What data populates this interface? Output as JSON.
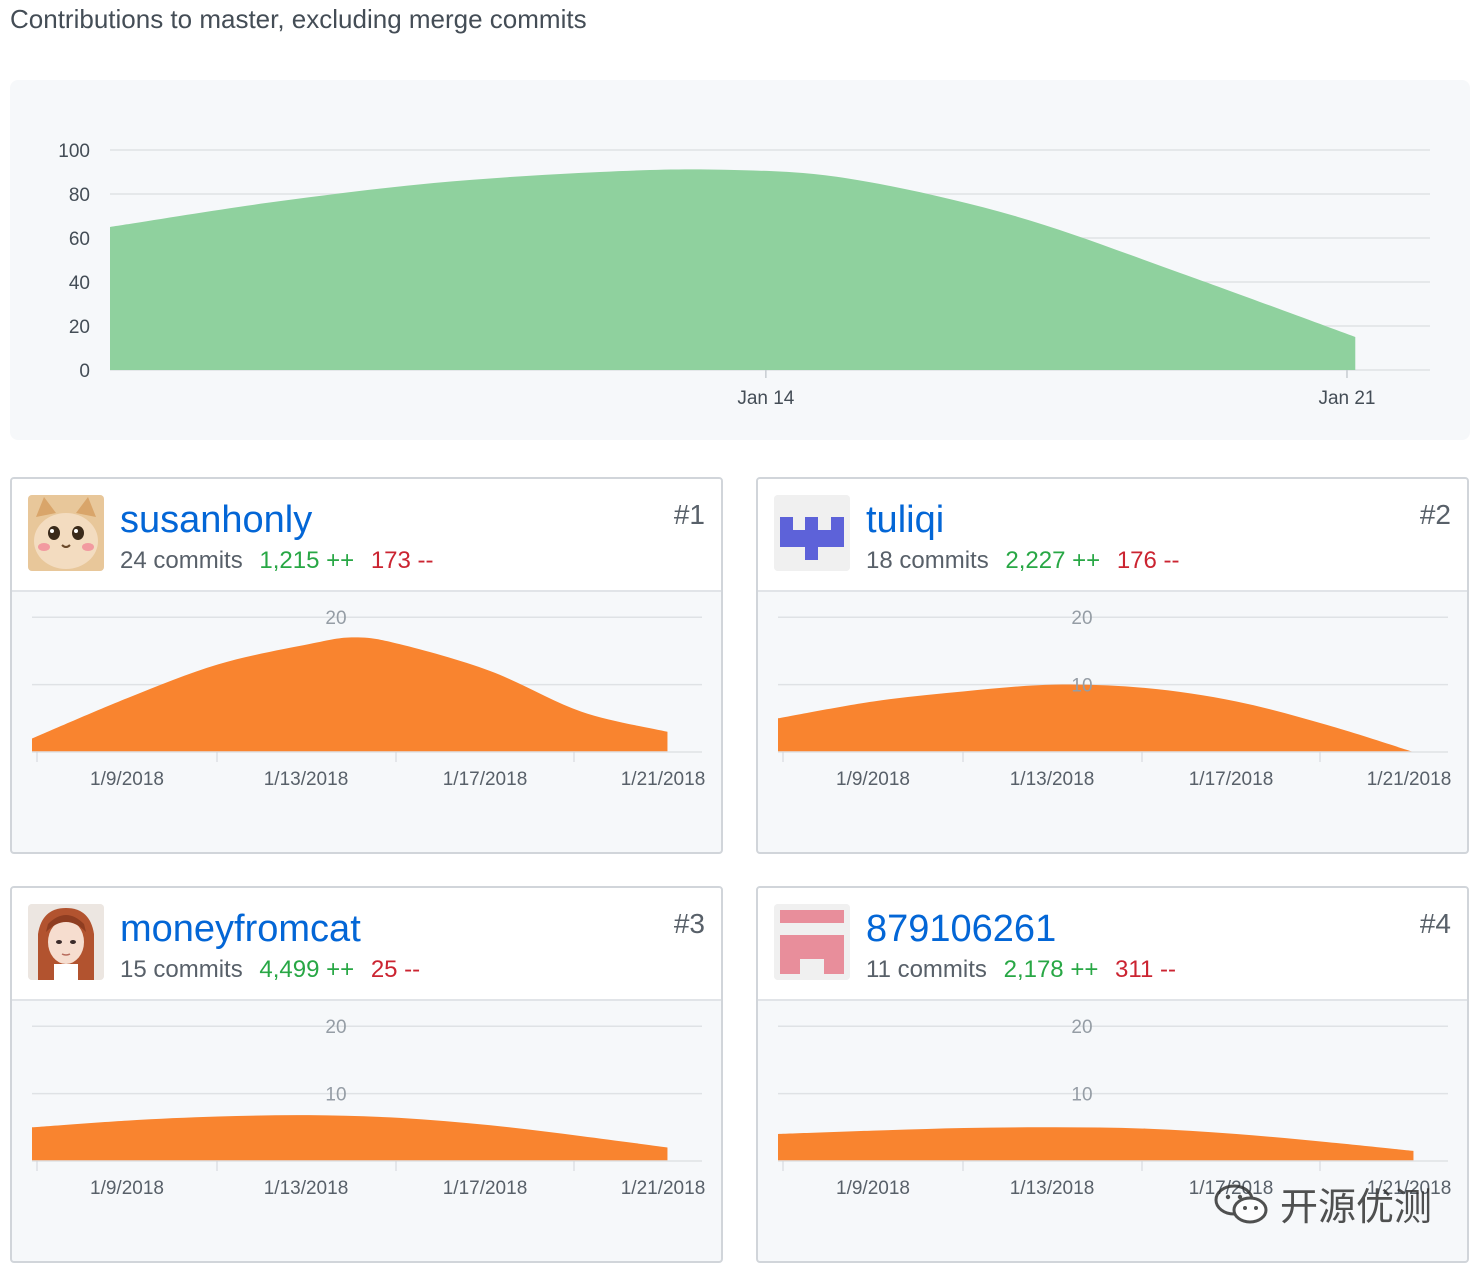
{
  "page": {
    "title": "Contributions to master, excluding merge commits"
  },
  "main_chart": {
    "chart_data": {
      "type": "area",
      "y_ticks": [
        "100",
        "80",
        "60",
        "40",
        "20",
        "0"
      ],
      "ylim": [
        0,
        100
      ],
      "x_ticks": [
        {
          "label": "Jan 14",
          "day": 14
        },
        {
          "label": "Jan 21",
          "day": 21
        }
      ],
      "xlim_days": [
        6.1,
        22
      ],
      "series": [
        {
          "x_days": [
            6.1,
            8,
            10,
            12,
            13.5,
            15,
            17,
            19,
            21.1
          ],
          "values": [
            65,
            76,
            85,
            90,
            91,
            87,
            70,
            44,
            15
          ]
        }
      ],
      "color": "#8fd19e"
    }
  },
  "contributors": [
    {
      "rank": "#1",
      "username": "susanhonly",
      "commits": "24 commits",
      "additions": "1,215 ++",
      "deletions": "173 --",
      "avatar": "cat-photo",
      "chart_data": {
        "type": "area",
        "y_ticks": [
          "20"
        ],
        "ylim": [
          0,
          23
        ],
        "x_labels": [
          "1/9/2018",
          "1/13/2018",
          "1/17/2018",
          "1/21/2018"
        ],
        "x_days": [
          6.9,
          9,
          11,
          13,
          14,
          15,
          17,
          19,
          20.9
        ],
        "values": [
          2,
          8,
          13,
          16,
          17,
          16,
          12,
          6,
          3
        ]
      }
    },
    {
      "rank": "#2",
      "username": "tuliqi",
      "commits": "18 commits",
      "additions": "2,227 ++",
      "deletions": "176 --",
      "avatar": "identicon-purple",
      "chart_data": {
        "type": "area",
        "y_ticks": [
          "20",
          "10"
        ],
        "ylim": [
          0,
          23
        ],
        "x_labels": [
          "1/9/2018",
          "1/13/2018",
          "1/17/2018",
          "1/21/2018"
        ],
        "x_days": [
          6.9,
          9,
          11,
          13,
          15,
          17,
          19,
          20.9
        ],
        "values": [
          5,
          7.5,
          9,
          10,
          9.5,
          7.5,
          4,
          0
        ]
      }
    },
    {
      "rank": "#3",
      "username": "moneyfromcat",
      "commits": "15 commits",
      "additions": "4,499 ++",
      "deletions": "25 --",
      "avatar": "anime-portrait",
      "chart_data": {
        "type": "area",
        "y_ticks": [
          "20",
          "10"
        ],
        "ylim": [
          0,
          23
        ],
        "x_labels": [
          "1/9/2018",
          "1/13/2018",
          "1/17/2018",
          "1/21/2018"
        ],
        "x_days": [
          6.9,
          9,
          11,
          13,
          15,
          17,
          19,
          20.9
        ],
        "values": [
          5,
          6,
          6.6,
          6.8,
          6.4,
          5.3,
          3.7,
          2
        ]
      }
    },
    {
      "rank": "#4",
      "username": "879106261",
      "commits": "11 commits",
      "additions": "2,178 ++",
      "deletions": "311 --",
      "avatar": "identicon-pink",
      "chart_data": {
        "type": "area",
        "y_ticks": [
          "20",
          "10"
        ],
        "ylim": [
          0,
          23
        ],
        "x_labels": [
          "1/9/2018",
          "1/13/2018",
          "1/17/2018",
          "1/21/2018"
        ],
        "x_days": [
          6.9,
          9,
          11,
          13,
          15,
          17,
          19,
          20.9
        ],
        "values": [
          4,
          4.5,
          4.9,
          5,
          4.8,
          4,
          2.8,
          1.5
        ]
      }
    }
  ],
  "watermark": {
    "text": "开源优测"
  }
}
